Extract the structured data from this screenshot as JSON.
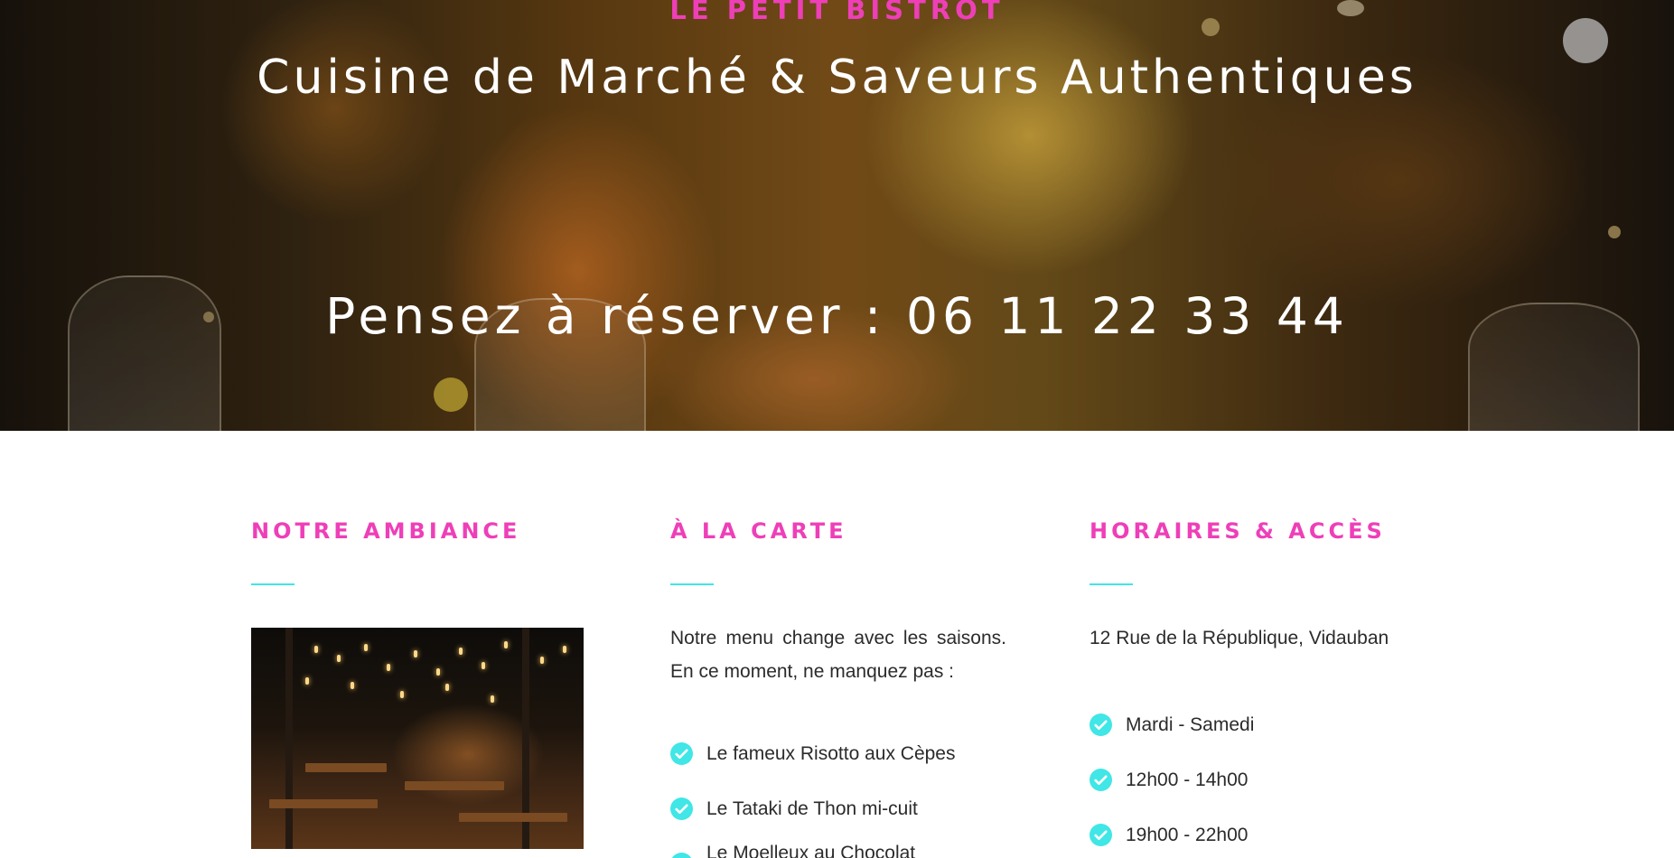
{
  "hero": {
    "brand": "LE PETIT BISTROT",
    "title": "Cuisine de Marché & Saveurs Authentiques",
    "phone_line": "Pensez à réserver : 06 11 22 33 44"
  },
  "ambiance": {
    "heading": "NOTRE AMBIANCE"
  },
  "carte": {
    "heading": "À LA CARTE",
    "intro": "Notre menu change avec les saisons. En ce moment, ne manquez pas :",
    "items": [
      {
        "label": "Le fameux Risotto aux Cèpes"
      },
      {
        "label": "Le Tataki de Thon mi-cuit"
      },
      {
        "label": "Le Moelleux au Chocolat légendaire"
      }
    ]
  },
  "horaires": {
    "heading": "HORAIRES & ACCÈS",
    "address": "12 Rue de la République, Vidauban",
    "items": [
      {
        "label": "Mardi - Samedi"
      },
      {
        "label": "12h00 - 14h00"
      },
      {
        "label": "19h00 - 22h00"
      }
    ]
  },
  "colors": {
    "accent_pink": "#ee3fb8",
    "accent_cyan": "#41e6e6",
    "text": "#2b2b2b"
  },
  "icons": {
    "list_bullet": "check-circle-icon"
  }
}
